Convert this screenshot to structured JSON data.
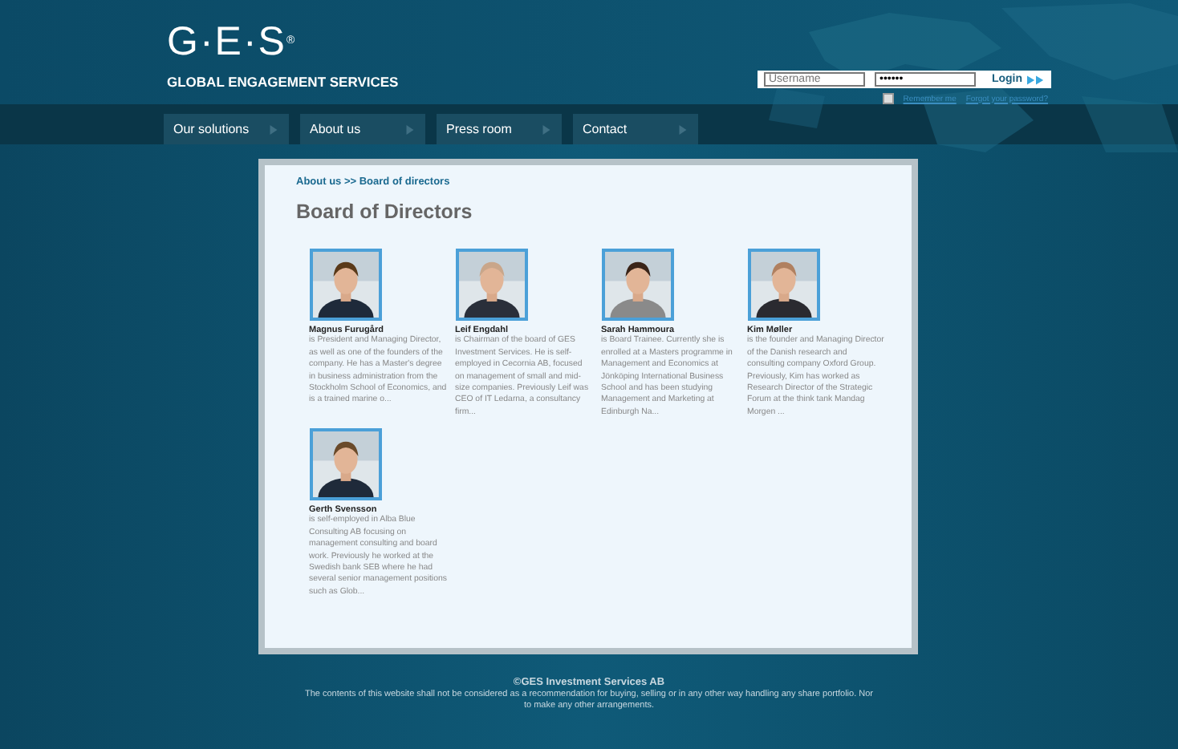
{
  "logo": {
    "mark": "G·E·S",
    "registered": "®",
    "tagline": "GLOBAL ENGAGEMENT SERVICES"
  },
  "login": {
    "username_placeholder": "Username",
    "password_value": "••••••",
    "button": "Login",
    "remember": {
      "label": "Remember me",
      "checked": false
    },
    "forgot": "Forgot your password?"
  },
  "nav": [
    {
      "label": "Our solutions",
      "selected": false
    },
    {
      "label": "About us",
      "selected": false
    },
    {
      "label": "Press room",
      "selected": false
    },
    {
      "label": "Contact",
      "selected": false
    }
  ],
  "breadcrumb": "About us >> Board of directors",
  "heading": "Board of Directors",
  "members": [
    {
      "name": "Magnus Furugård",
      "bio": "is President and Managing Director, as well as one of the founders of the company. He has a Master's degree in business administration from the Stockholm School of Economics, and is a trained marine o..."
    },
    {
      "name": "Leif Engdahl",
      "bio": "is Chairman of the board of GES Investment Services. He is self-employed in Cecornia AB, focused on management of small and mid-size companies. Previously Leif was CEO of IT Ledarna, a consultancy firm..."
    },
    {
      "name": "Sarah Hammoura",
      "bio": "is Board Trainee. Currently she is enrolled at a Masters programme in Management and Economics at Jönköping International Business School and has been studying Management and Marketing at Edinburgh Na..."
    },
    {
      "name": "Kim Møller",
      "bio": "is the founder and Managing Director of the Danish research and consulting company Oxford Group. Previously, Kim has worked as Research Director of the Strategic Forum at the think tank Mandag Morgen ..."
    },
    {
      "name": "Gerth Svensson",
      "bio": "is self-employed in Alba Blue Consulting AB focusing on management consulting and board work. Previously he worked at the Swedish bank SEB where he had several senior management positions such as Glob..."
    }
  ],
  "footer": {
    "copyright": "©GES Investment Services AB",
    "disclaimer": "The contents of this website shall not be considered as a recommendation for buying, selling or in any other way handling any share portfolio. Nor to make any other arrangements."
  }
}
